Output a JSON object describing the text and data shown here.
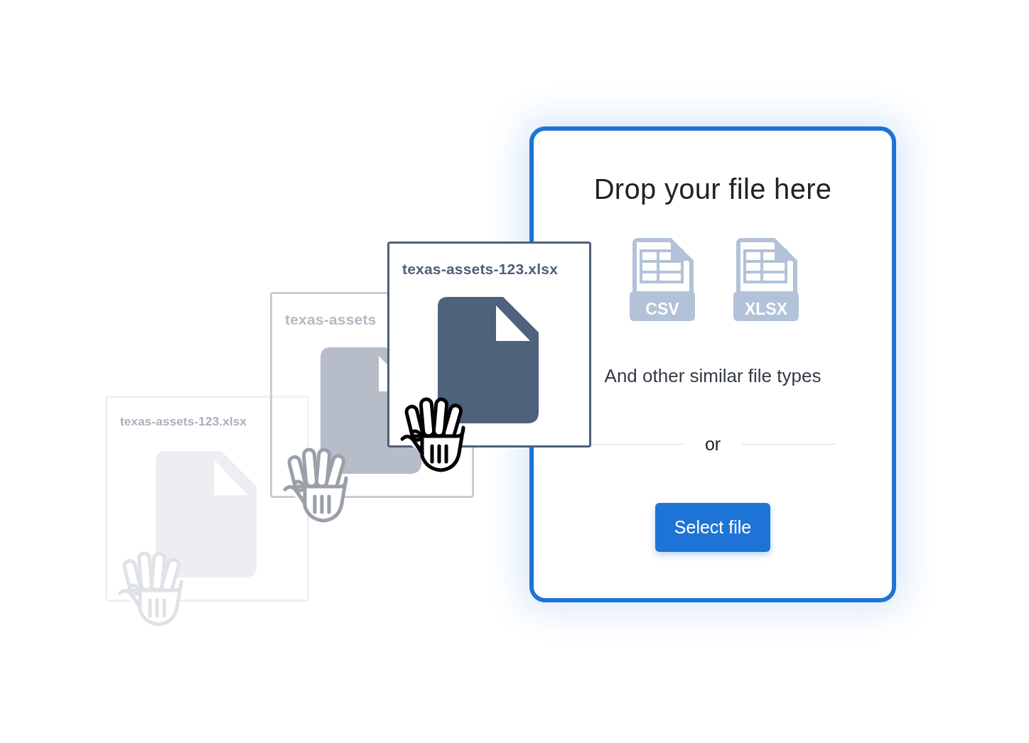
{
  "dragged_files": [
    {
      "name": "texas-assets-123.xlsx",
      "kind": "faint"
    },
    {
      "name": "texas-assets",
      "kind": "ghost"
    },
    {
      "name": "texas-assets-123.xlsx",
      "kind": "solid"
    }
  ],
  "drop_zone": {
    "title": "Drop your file here",
    "file_types": [
      {
        "label": "CSV"
      },
      {
        "label": "XLSX"
      }
    ],
    "note": "And other similar file types",
    "separator": "or",
    "button": "Select file"
  }
}
